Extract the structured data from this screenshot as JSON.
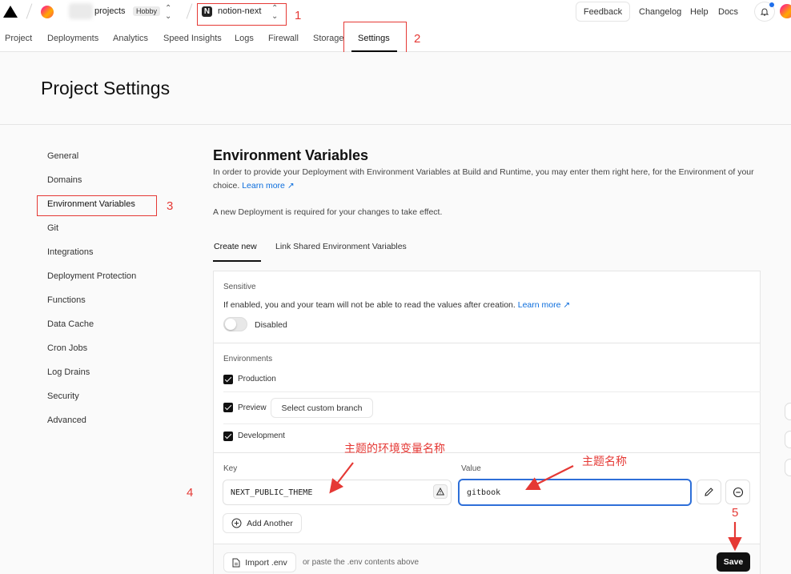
{
  "header": {
    "team_name": "projects",
    "plan_badge": "Hobby",
    "project_name": "notion-next",
    "feedback_label": "Feedback",
    "links": [
      "Changelog",
      "Help",
      "Docs"
    ]
  },
  "tabs": [
    "Project",
    "Deployments",
    "Analytics",
    "Speed Insights",
    "Logs",
    "Firewall",
    "Storage",
    "Settings"
  ],
  "active_tab": "Settings",
  "page_title": "Project Settings",
  "sidebar": [
    "General",
    "Domains",
    "Environment Variables",
    "Git",
    "Integrations",
    "Deployment Protection",
    "Functions",
    "Data Cache",
    "Cron Jobs",
    "Log Drains",
    "Security",
    "Advanced"
  ],
  "env": {
    "heading": "Environment Variables",
    "description": "In order to provide your Deployment with Environment Variables at Build and Runtime, you may enter them right here, for the Environment of your choice.",
    "learn_more": "Learn more",
    "notice": "A new Deployment is required for your changes to take effect.",
    "subtabs": [
      "Create new",
      "Link Shared Environment Variables"
    ],
    "sensitive_label": "Sensitive",
    "sensitive_desc": "If enabled, you and your team will not be able to read the values after creation.",
    "sensitive_state": "Disabled",
    "environments_label": "Environments",
    "env_production": "Production",
    "env_preview": "Preview",
    "select_branch": "Select custom branch",
    "env_development": "Development",
    "key_label": "Key",
    "value_label": "Value",
    "key_value": "NEXT_PUBLIC_THEME",
    "value_value": "gitbook",
    "add_another": "Add Another",
    "import_env": "Import .env",
    "paste_hint": "or paste the .env contents above",
    "save": "Save"
  },
  "annotations": {
    "n1": "1",
    "n2": "2",
    "n3": "3",
    "n4": "4",
    "n5": "5",
    "key_note": "主题的环境变量名称",
    "value_note": "主题名称"
  },
  "colors": {
    "accent": "#2e6fd8",
    "annotation": "#e53935",
    "link": "#0a6cdc"
  }
}
